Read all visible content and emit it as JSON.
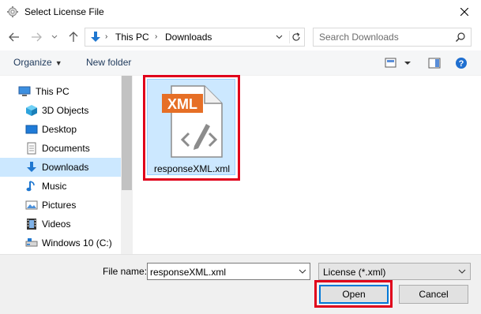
{
  "window": {
    "title": "Select License File"
  },
  "address": {
    "crumbs": [
      "This PC",
      "Downloads"
    ]
  },
  "search": {
    "placeholder": "Search Downloads"
  },
  "toolbar": {
    "organize_label": "Organize",
    "new_folder_label": "New folder"
  },
  "sidebar": {
    "items": [
      {
        "label": "This PC",
        "icon": "computer-icon"
      },
      {
        "label": "3D Objects",
        "icon": "cube-3d-icon"
      },
      {
        "label": "Desktop",
        "icon": "desktop-icon"
      },
      {
        "label": "Documents",
        "icon": "documents-icon"
      },
      {
        "label": "Downloads",
        "icon": "download-arrow-icon",
        "selected": true
      },
      {
        "label": "Music",
        "icon": "music-note-icon"
      },
      {
        "label": "Pictures",
        "icon": "pictures-icon"
      },
      {
        "label": "Videos",
        "icon": "film-icon"
      },
      {
        "label": "Windows 10 (C:)",
        "icon": "drive-icon"
      }
    ]
  },
  "files": [
    {
      "name": "responseXML.xml",
      "badge": "XML",
      "icon": "xml-file-icon",
      "selected": true
    }
  ],
  "footer": {
    "file_name_label": "File name:",
    "file_name_value": "responseXML.xml",
    "file_type": "License (*.xml)",
    "open_label": "Open",
    "cancel_label": "Cancel"
  },
  "colors": {
    "selection": "#cce8ff",
    "highlight_box": "#e0001b",
    "xml_badge": "#e66f26",
    "accent": "#0078d7"
  }
}
